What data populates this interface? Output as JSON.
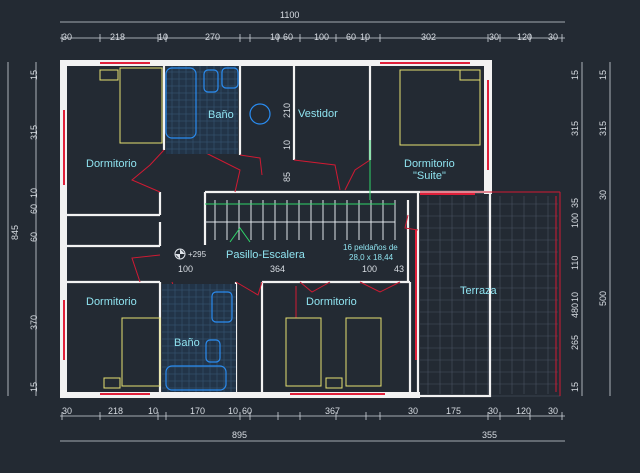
{
  "dimensions": {
    "top_total": "1100",
    "top": [
      "30",
      "218",
      "10",
      "270",
      "10",
      "60",
      "100",
      "60",
      "10",
      "302",
      "30",
      "120",
      "30"
    ],
    "bottom": [
      "30",
      "218",
      "10",
      "170",
      "10",
      "60",
      "367",
      "30",
      "175",
      "30",
      "120",
      "30"
    ],
    "bottom_totals": [
      "895",
      "355"
    ],
    "left_total": "845",
    "left": [
      "15",
      "315",
      "60",
      "10",
      "60",
      "370",
      "15"
    ],
    "right_inner": [
      "15",
      "315",
      "35",
      "100",
      "110",
      "10",
      "265",
      "15"
    ],
    "right_outer": [
      "15",
      "315",
      "30",
      "480",
      "500"
    ],
    "interior": [
      "210",
      "10",
      "85",
      "100",
      "364",
      "100",
      "43"
    ],
    "level": "+295"
  },
  "rooms": {
    "dormitorio_nw": "Dormitorio",
    "bano_top": "Baño",
    "vestidor": "Vestidor",
    "suite_line1": "Dormitorio",
    "suite_line2": "\"Suite\"",
    "pasillo": "Pasillo-Escalera",
    "dormitorio_sw": "Dormitorio",
    "bano_bottom": "Baño",
    "dormitorio_s": "Dormitorio",
    "terraza": "Terraza"
  },
  "notes": {
    "stairs_line1": "16 peldaños de",
    "stairs_line2": "28,0 x 18,44"
  },
  "colors": {
    "background": "#232a33",
    "walls": "#f2f2f2",
    "windows": "#e0203a",
    "furniture": "#e4e070",
    "sanitary": "#2a8cf0",
    "labels": "#8fe3f0"
  },
  "icons": [
    "level-marker-icon"
  ]
}
